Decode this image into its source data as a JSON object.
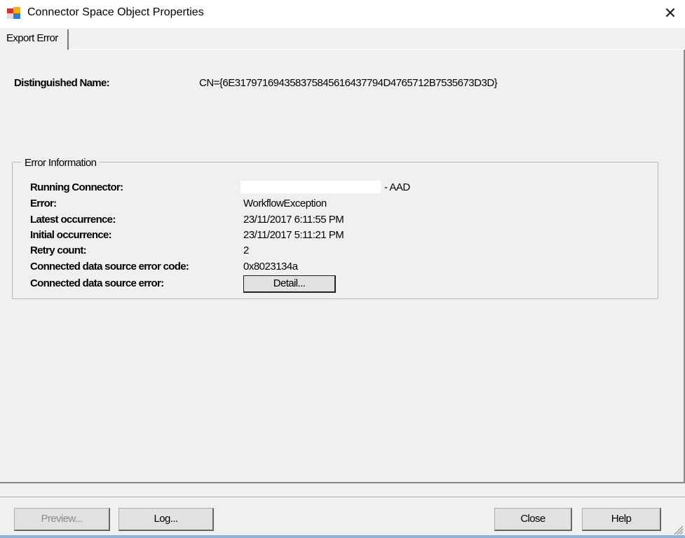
{
  "window": {
    "title": "Connector Space Object Properties",
    "close_glyph": "✕"
  },
  "tabs": [
    {
      "label": "Export Error",
      "selected": true
    }
  ],
  "distinguished_name": {
    "label": "Distinguished Name:",
    "value": "CN={6E317971694358375845616437794D4765712B7535673D3D}"
  },
  "error_information": {
    "title": "Error Information",
    "rows": [
      {
        "label": "Running Connector:",
        "value": "- AAD"
      },
      {
        "label": "Error:",
        "value": "WorkflowException"
      },
      {
        "label": "Latest occurrence:",
        "value": "23/11/2017 6:11:55 PM"
      },
      {
        "label": "Initial occurrence:",
        "value": "23/11/2017 5:11:21 PM"
      },
      {
        "label": "Retry count:",
        "value": "2"
      },
      {
        "label": "Connected data source error code:",
        "value": "0x8023134a"
      },
      {
        "label": "Connected data source error:",
        "value": ""
      }
    ],
    "detail_button": "Detail..."
  },
  "footer": {
    "preview": "Preview...",
    "log": "Log...",
    "close": "Close",
    "help": "Help"
  }
}
